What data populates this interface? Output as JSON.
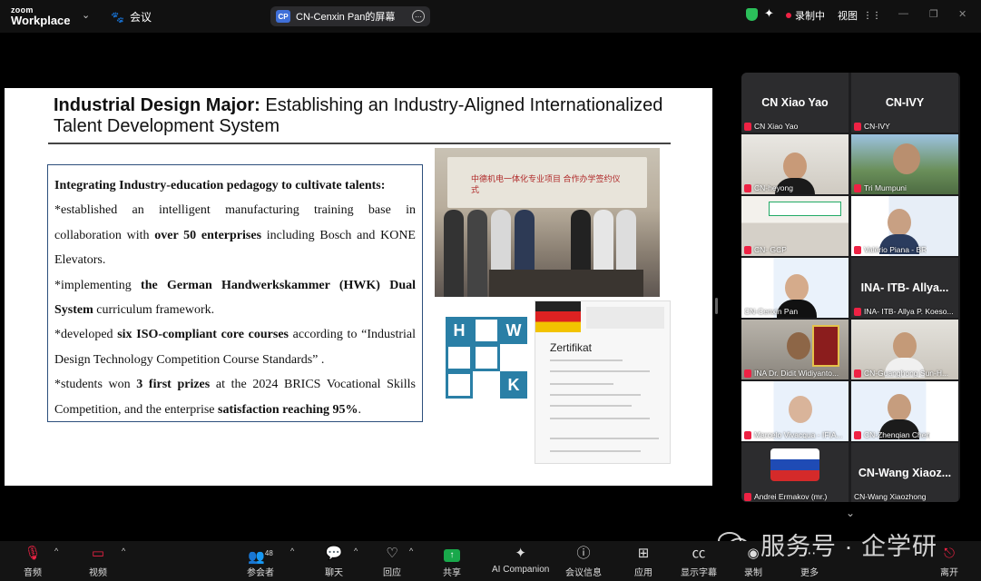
{
  "topbar": {
    "logo_line1": "zoom",
    "logo_line2": "Workplace",
    "meetings_label": "会议",
    "share_title": "CN-Cenxin Pan的屏幕",
    "share_badge": "CP",
    "recording_label": "录制中",
    "view_label": "视图"
  },
  "slide": {
    "title_bold": "Industrial Design Major:",
    "title_rest": " Establishing an Industry-Aligned Internationalized Talent Development System",
    "p1_bold": "Integrating Industry-education pedagogy to cultivate talents:",
    "p2_a": "*established an intelligent manufacturing training base in collaboration with ",
    "p2_b": "over 50 enterprises",
    "p2_c": " including Bosch and KONE Elevators.",
    "p3_a": "*implementing ",
    "p3_b": "the German Handwerkskammer (HWK) Dual System",
    "p3_c": " curriculum framework.",
    "p4_a": "*developed ",
    "p4_b": "six ISO-compliant core courses",
    "p4_c": " according to “Industrial Design Technology Competition Course Standards” .",
    "p5_a": "*students won ",
    "p5_b": "3 first prizes",
    "p5_c": " at the 2024 BRICS Vocational Skills Competition, and the enterprise ",
    "p5_d": "satisfaction reaching 95%",
    "p5_e": ".",
    "photo_banner": "中德机电一体化专业项目 合作办学签约仪式",
    "cert_title": "Zertifikat",
    "hwk_letters": [
      "H",
      "W",
      "K"
    ]
  },
  "gallery": {
    "tiles": [
      {
        "big": "CN Xiao Yao",
        "name": "CN Xiao Yao"
      },
      {
        "big": "CN-IVY",
        "name": "CN-IVY"
      },
      {
        "big": "",
        "name": "CN-heyong"
      },
      {
        "big": "",
        "name": "Tri Mumpuni"
      },
      {
        "big": "",
        "name": "CN- GCP"
      },
      {
        "big": "",
        "name": "Valério Piana - BR"
      },
      {
        "big": "",
        "name": "CN-Cenxin Pan"
      },
      {
        "big": "INA- ITB- Allya...",
        "name": "INA- ITB- Allya P. Koeso..."
      },
      {
        "big": "",
        "name": "INA Dr. Didit Widiyanto..."
      },
      {
        "big": "",
        "name": "CN-Guanghong Sun-H..."
      },
      {
        "big": "",
        "name": "Marcelo Vivacqua - IFIA..."
      },
      {
        "big": "",
        "name": "CN-Zhenqian Chen"
      },
      {
        "big": "",
        "name": "Andrei Ermakov (mr.)"
      },
      {
        "big": "CN-Wang Xiaoz...",
        "name": "CN-Wang Xiaozhong"
      }
    ]
  },
  "toolbar": {
    "audio": "音频",
    "video": "视频",
    "participants": "参会者",
    "participants_count": "48",
    "chat": "聊天",
    "react": "回应",
    "share": "共享",
    "ai": "AI Companion",
    "info": "会议信息",
    "apps": "应用",
    "captions": "显示字幕",
    "record": "录制",
    "more": "更多",
    "leave": "离开"
  },
  "watermark": "服务号 · 企学研"
}
